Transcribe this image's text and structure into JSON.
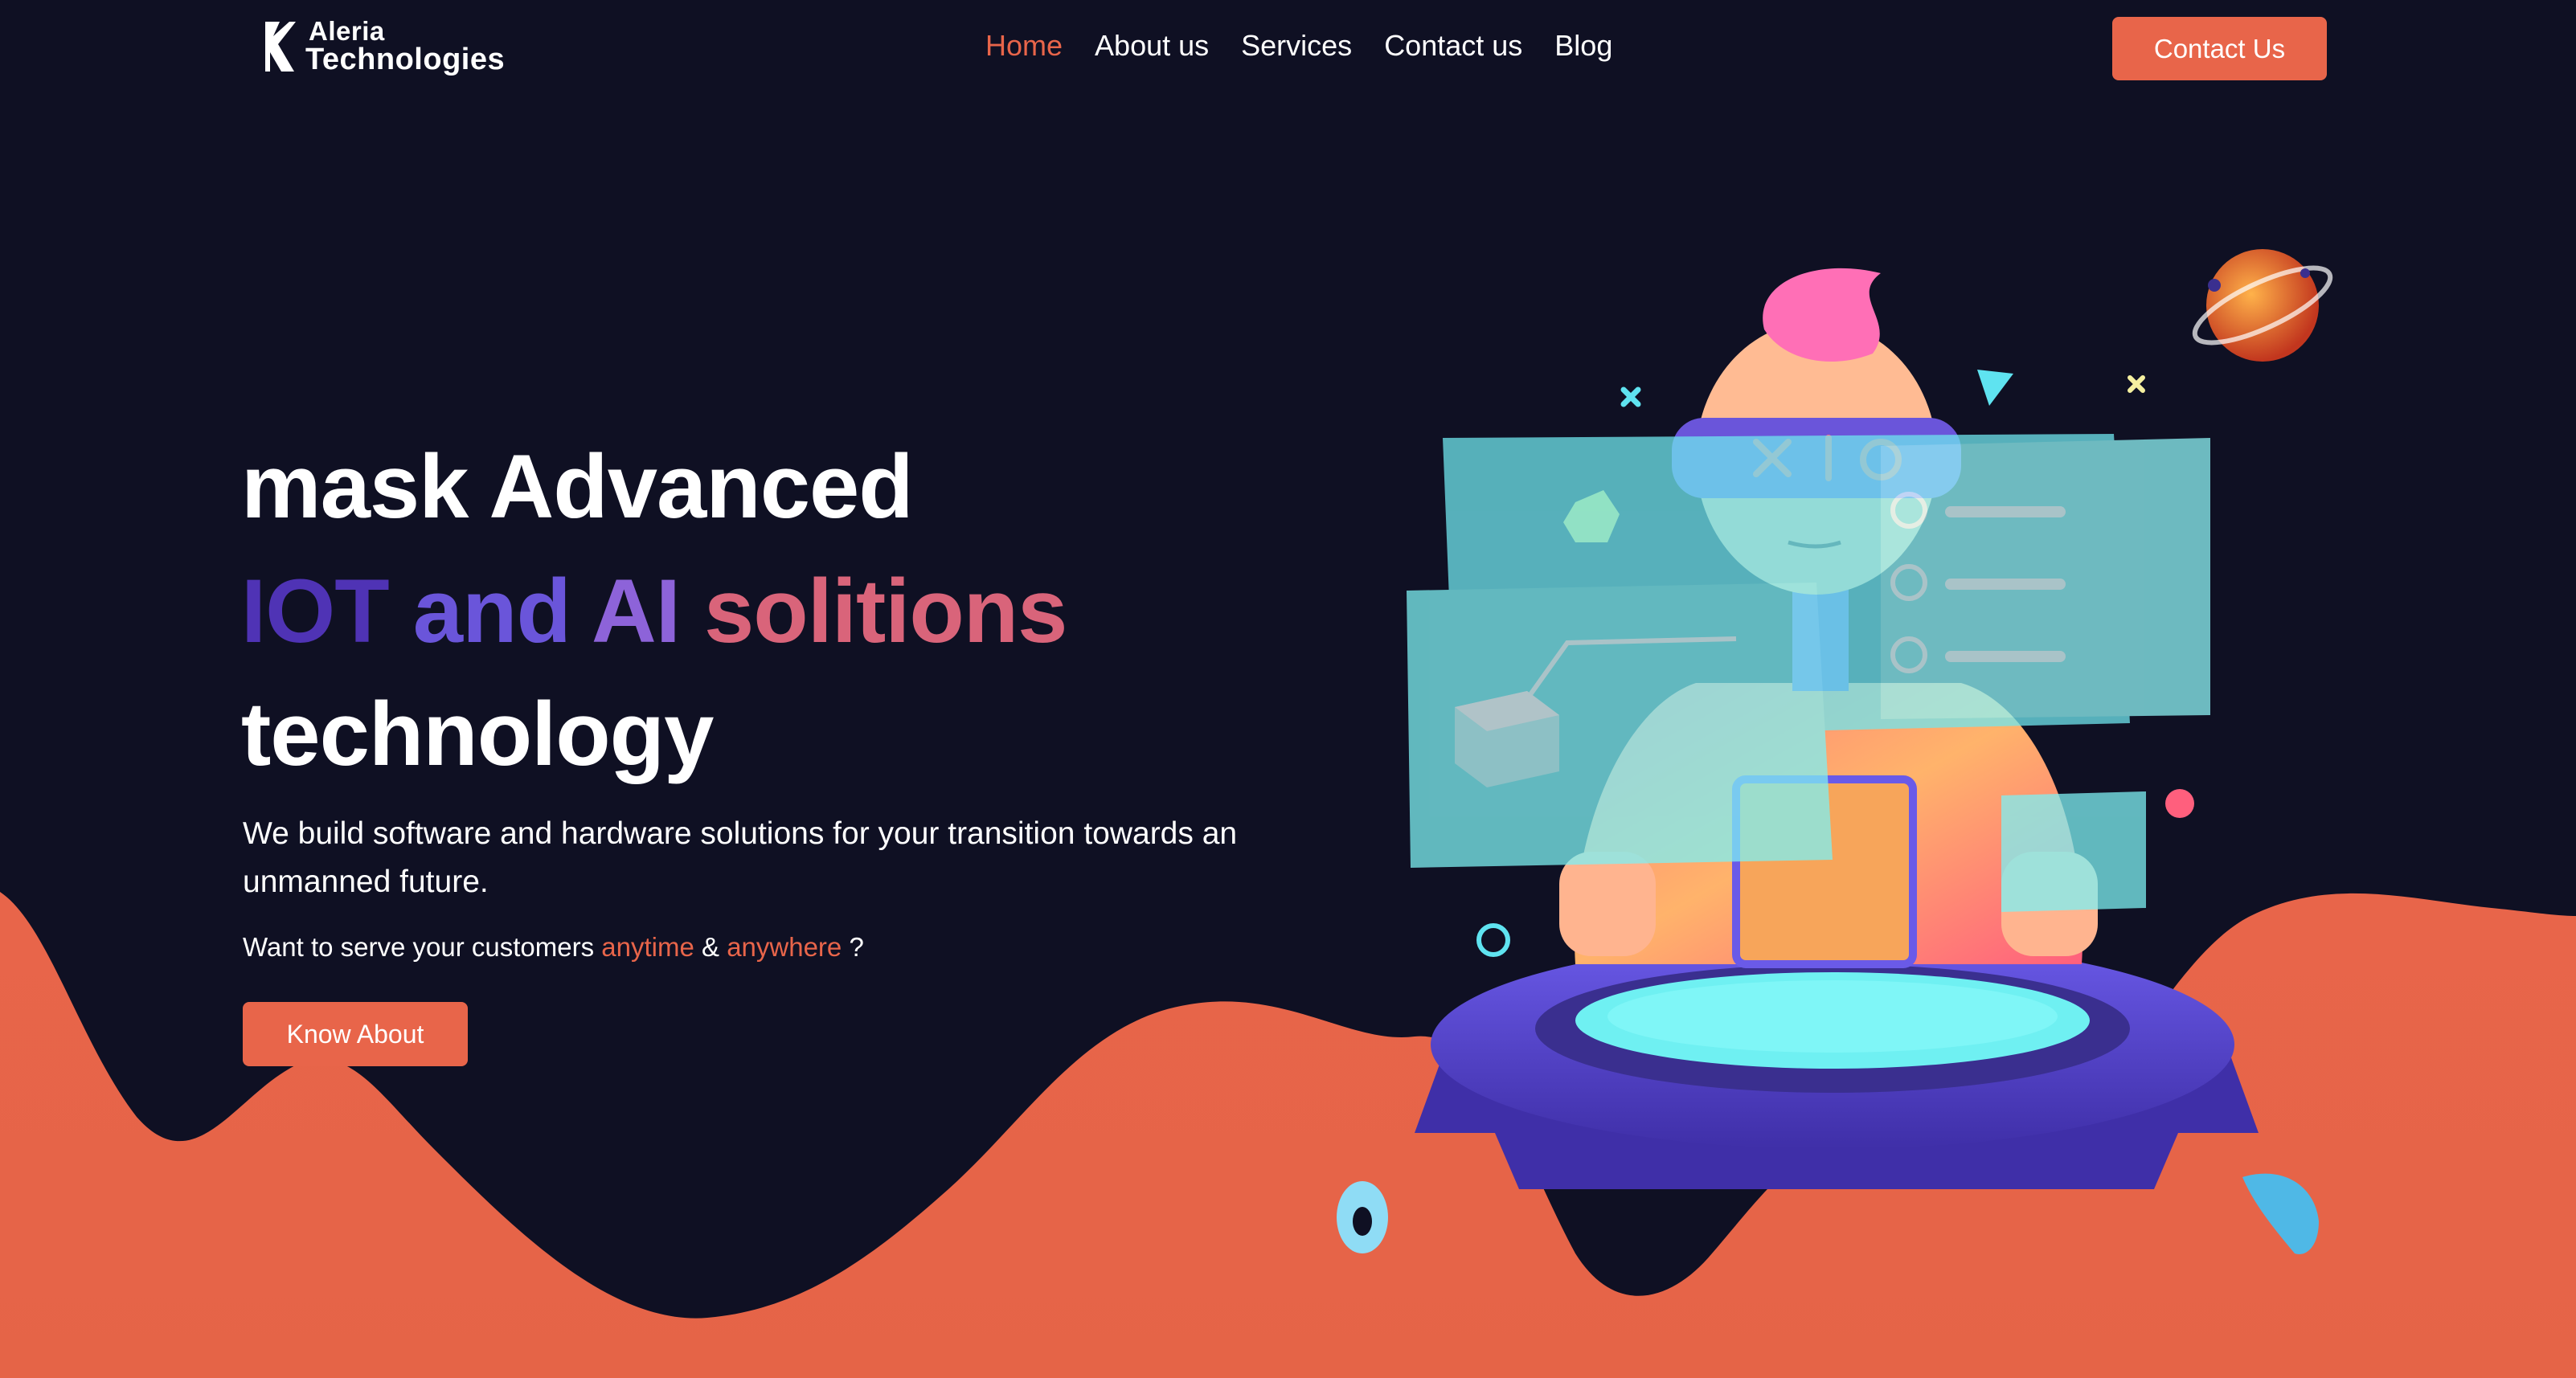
{
  "header": {
    "logo_line1": "Aleria",
    "logo_line2": "Technologies",
    "nav": [
      {
        "label": "Home",
        "active": true
      },
      {
        "label": "About us",
        "active": false
      },
      {
        "label": "Services",
        "active": false
      },
      {
        "label": "Contact us",
        "active": false
      },
      {
        "label": "Blog",
        "active": false
      }
    ],
    "cta_label": "Contact Us"
  },
  "hero": {
    "title_line1": "mask Advanced",
    "title_line2_parts": [
      "IOT",
      "and",
      "AI",
      "solitions"
    ],
    "title_line3": "technology",
    "description": "We build software and hardware solutions for your transition towards an unmanned future.",
    "question_prefix": "Want to serve your customers",
    "question_word1": "anytime",
    "question_amp": "&",
    "question_word2": "anywhere",
    "question_suffix": "?",
    "button_label": "Know About"
  },
  "colors": {
    "background": "#0f1023",
    "accent": "#e8654a",
    "wave": "#e8654a",
    "gradient_start": "#4f33b5",
    "gradient_end": "#e8654a"
  },
  "icons": [
    "logo-mark-icon",
    "robot-illustration",
    "planet-icon"
  ]
}
